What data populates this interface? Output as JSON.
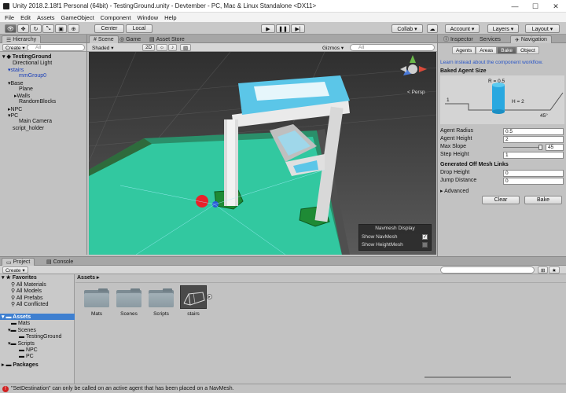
{
  "window": {
    "title": "Unity 2018.2.18f1 Personal (64bit) - TestingGround.unity - Devtember - PC, Mac & Linux Standalone <DX11>",
    "minimize": "—",
    "maximize": "☐",
    "close": "✕"
  },
  "menu": [
    "File",
    "Edit",
    "Assets",
    "GameObject",
    "Component",
    "Window",
    "Help"
  ],
  "toolbar": {
    "pivot": "Center",
    "space": "Local",
    "collab": "Collab ▾",
    "account": "Account ▾",
    "layers": "Layers ▾",
    "layout": "Layout ▾"
  },
  "hierarchy": {
    "tab": "Hierarchy",
    "create": "Create ▾",
    "search_placeholder": "All",
    "scene": "TestingGround",
    "items": [
      "Directional Light",
      "stairs",
      "mmGroup0",
      "Base",
      "Plane",
      "Walls",
      "RandomBlocks",
      "NPC",
      "PC",
      "Main Camera",
      "script_holder"
    ]
  },
  "scene": {
    "tabs": [
      "Scene",
      "Game",
      "Asset Store"
    ],
    "shading": "Shaded ▾",
    "mode2d": "2D",
    "gizmos": "Gizmos ▾",
    "search_placeholder": "All",
    "persp": "< Persp",
    "navmesh_display": {
      "title": "Navmesh Display",
      "show_navmesh": "Show NavMesh",
      "show_heightmesh": "Show HeightMesh"
    }
  },
  "inspector": {
    "tabs": [
      "Inspector",
      "Services",
      "Navigation"
    ],
    "subtabs": [
      "Agents",
      "Areas",
      "Bake",
      "Object"
    ],
    "learn_link": "Learn instead about the component workflow.",
    "baked_agent_size": "Baked Agent Size",
    "diagram": {
      "r": "R = 0.5",
      "h": "H = 2",
      "step": "1",
      "slope": "45°"
    },
    "fields": [
      {
        "label": "Agent Radius",
        "value": "0.5"
      },
      {
        "label": "Agent Height",
        "value": "2"
      },
      {
        "label": "Max Slope",
        "value": "45"
      },
      {
        "label": "Step Height",
        "value": "1"
      }
    ],
    "max_slope_level": 1.0,
    "offmesh_title": "Generated Off Mesh Links",
    "offmesh_fields": [
      {
        "label": "Drop Height",
        "value": "0"
      },
      {
        "label": "Jump Distance",
        "value": "0"
      }
    ],
    "advanced": "Advanced",
    "clear": "Clear",
    "bake": "Bake"
  },
  "project": {
    "tabs": [
      "Project",
      "Console"
    ],
    "create": "Create ▾",
    "favorites": "Favorites",
    "favorite_items": [
      "All Materials",
      "All Models",
      "All Prefabs",
      "All Conflicted"
    ],
    "assets_root": "Assets",
    "tree": [
      "Mats",
      "Scenes",
      "TestingGround",
      "Scripts",
      "NPC",
      "PC",
      "Packages"
    ],
    "breadcrumb": "Assets ▸",
    "assets": [
      "Mats",
      "Scenes",
      "Scripts",
      "stairs"
    ]
  },
  "status": {
    "message": "\"SetDestination\" can only be called on an active agent that has been placed on a NavMesh."
  },
  "colors": {
    "navmesh": "#32c8a0",
    "accent": "#3e7fd0",
    "link": "#2a56c6",
    "error": "#d02020"
  }
}
